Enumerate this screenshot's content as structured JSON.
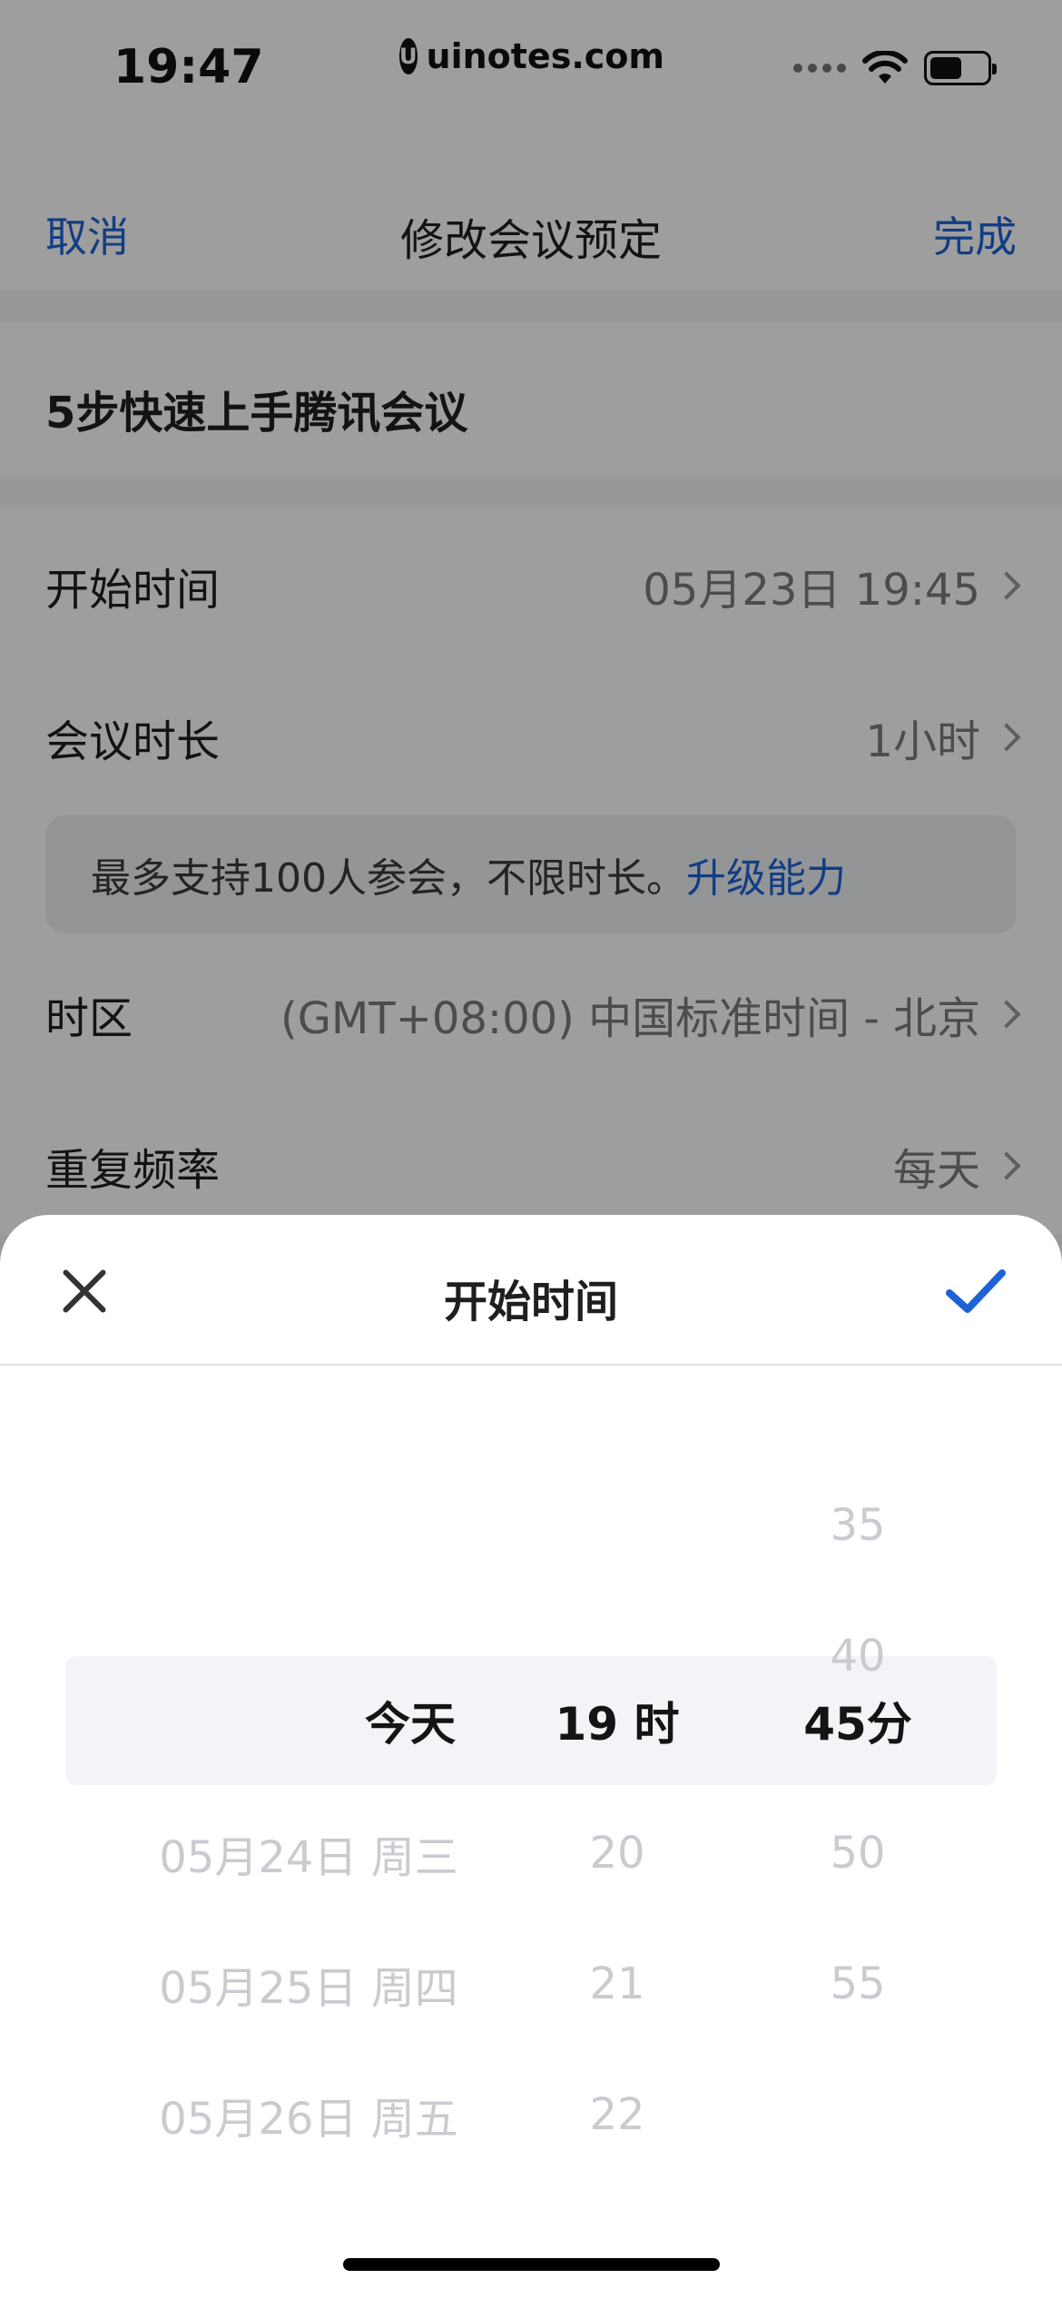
{
  "status_bar": {
    "time": "19:47",
    "watermark": "uinotes.com",
    "watermark_logo": "U"
  },
  "nav": {
    "cancel": "取消",
    "title": "修改会议预定",
    "done": "完成"
  },
  "meeting_name": "5步快速上手腾讯会议",
  "settings": {
    "start_time": {
      "label": "开始时间",
      "value": "05月23日 19:45"
    },
    "duration": {
      "label": "会议时长",
      "value": "1小时"
    },
    "notice": {
      "text": "最多支持100人参会，不限时长。",
      "link": "升级能力"
    },
    "timezone": {
      "label": "时区",
      "value": "(GMT+08:00) 中国标准时间 - 北京"
    },
    "repeat": {
      "label": "重复频率",
      "value": "每天"
    }
  },
  "sheet": {
    "title": "开始时间",
    "close_icon": "close-icon",
    "confirm_icon": "check-icon",
    "accent_color": "#1d63d6",
    "date_column": {
      "above": [
        "",
        ""
      ],
      "selected": "今天",
      "below": [
        "05月24日 周三",
        "05月25日 周四",
        "05月26日 周五"
      ]
    },
    "hour_column": {
      "above": [
        "",
        ""
      ],
      "selected": "19 时",
      "below": [
        "20",
        "21",
        "22"
      ]
    },
    "minute_column": {
      "above": [
        "35",
        "40"
      ],
      "selected": "45分",
      "below": [
        "50",
        "55"
      ]
    }
  }
}
